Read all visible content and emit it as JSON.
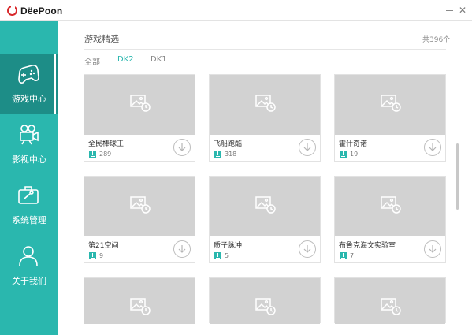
{
  "app": {
    "brand": "DëePoon"
  },
  "window": {
    "minimize_label": "",
    "close_label": "✕"
  },
  "sidebar": {
    "items": [
      {
        "label": "游戏中心",
        "icon": "gamepad-icon",
        "active": true
      },
      {
        "label": "影视中心",
        "icon": "movie-camera-icon",
        "active": false
      },
      {
        "label": "系统管理",
        "icon": "toolbox-icon",
        "active": false
      },
      {
        "label": "关于我们",
        "icon": "user-icon",
        "active": false
      }
    ]
  },
  "header": {
    "title": "游戏精选",
    "count": "共396个"
  },
  "tabs": [
    {
      "label": "全部",
      "active": false
    },
    {
      "label": "DK2",
      "active": true
    },
    {
      "label": "DK1",
      "active": false
    }
  ],
  "games": [
    {
      "name": "全民棒球王",
      "downloads": "289"
    },
    {
      "name": "飞船跑酷",
      "downloads": "318"
    },
    {
      "name": "霍什奇诺",
      "downloads": "19"
    },
    {
      "name": "第21空间",
      "downloads": "9"
    },
    {
      "name": "质子脉冲",
      "downloads": "5"
    },
    {
      "name": "布鲁克海文实验室",
      "downloads": "7"
    }
  ],
  "colors": {
    "accent": "#2ab7ae",
    "sidebar_active": "#1d8d87",
    "thumb": "#d2d2d2"
  }
}
